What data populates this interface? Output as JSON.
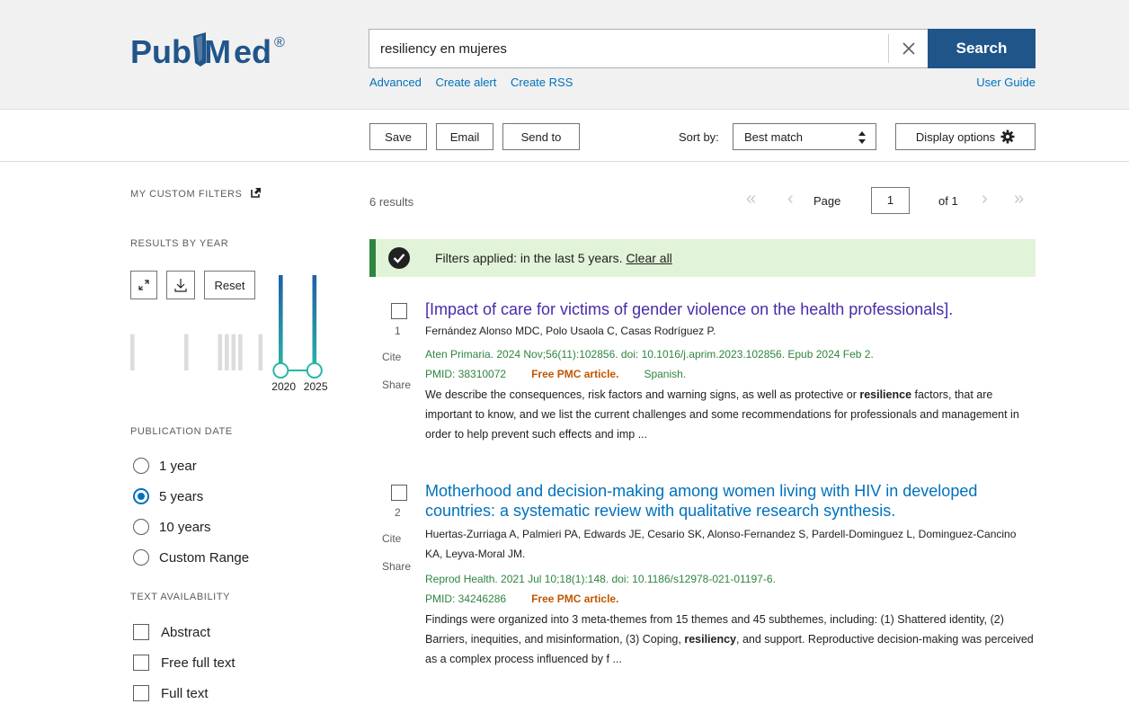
{
  "header": {
    "logo_text_left": "Pub",
    "logo_text_right": "ed",
    "logo_reg": "®",
    "search_value": "resiliency en mujeres",
    "search_button": "Search",
    "links": [
      "Advanced",
      "Create alert",
      "Create RSS"
    ],
    "user_guide": "User Guide"
  },
  "actions": {
    "save": "Save",
    "email": "Email",
    "send_to": "Send to",
    "sort_by_label": "Sort by:",
    "sort_value": "Best match",
    "display_options": "Display options"
  },
  "sidebar": {
    "custom_filters": "MY CUSTOM FILTERS",
    "results_by_year": "RESULTS BY YEAR",
    "reset": "Reset",
    "year_chart": {
      "start_label": "2020",
      "end_label": "2025",
      "selected_range": [
        2020,
        2025
      ],
      "bar_heights": [
        0.38,
        0,
        0,
        0,
        0,
        0,
        0,
        0,
        0.38,
        0,
        0,
        0,
        0,
        0.38,
        0.38,
        0.38,
        0.38,
        0,
        0,
        0.38,
        0,
        0,
        1.0,
        0,
        0,
        0,
        0,
        1.0
      ],
      "highlight_indices": [
        22,
        27
      ],
      "bar_colors": {
        "inactive": "#dcdcdc",
        "top": "#1f5fa8",
        "bottom": "#2ab6a4"
      }
    },
    "publication_date": "PUBLICATION DATE",
    "date_options": [
      {
        "label": "1 year",
        "checked": false
      },
      {
        "label": "5 years",
        "checked": true
      },
      {
        "label": "10 years",
        "checked": false
      },
      {
        "label": "Custom Range",
        "checked": false
      }
    ],
    "text_availability": "TEXT AVAILABILITY",
    "text_options": [
      "Abstract",
      "Free full text",
      "Full text"
    ]
  },
  "main": {
    "results_count": "6 results",
    "pager": {
      "page_label": "Page",
      "page_value": "1",
      "of_label": "of 1"
    },
    "filter_banner": {
      "text": "Filters applied: in the last 5 years.",
      "clear": "Clear all"
    },
    "results": [
      {
        "num": "1",
        "title": "[Impact of care for victims of gender violence on the health professionals].",
        "authors": "Fernández Alonso MDC, Polo Usaola C, Casas Rodríguez P.",
        "journal": "Aten Primaria. 2024 Nov;56(11):102856. doi: 10.1016/j.aprim.2023.102856. Epub 2024 Feb 2.",
        "pmid": "PMID: 38310072",
        "free": "Free PMC article.",
        "lang": "Spanish.",
        "snippet_pre": "We describe the consequences, risk factors and warning signs, as well as protective or ",
        "snippet_bold": "resilience",
        "snippet_post": " factors, that are important to know, and we list the current challenges and some recommendations for professionals and management in order to help prevent such effects and imp ..."
      },
      {
        "num": "2",
        "title": "Motherhood and decision-making among women living with HIV in developed countries: a systematic review with qualitative research synthesis.",
        "authors": "Huertas-Zurriaga A, Palmieri PA, Edwards JE, Cesario SK, Alonso-Fernandez S, Pardell-Dominguez L, Dominguez-Cancino KA, Leyva-Moral JM.",
        "journal": "Reprod Health. 2021 Jul 10;18(1):148. doi: 10.1186/s12978-021-01197-6.",
        "pmid": "PMID: 34246286",
        "free": "Free PMC article.",
        "lang": "",
        "snippet_pre": "Findings were organized into 3 meta-themes from 15 themes and 45 subthemes, including: (1) Shattered identity, (2) Barriers, inequities, and misinformation, (3) Coping, ",
        "snippet_bold": "resiliency",
        "snippet_post": ", and support. Reproductive decision-making was perceived as a complex process influenced by f ..."
      }
    ],
    "cite": "Cite",
    "share": "Share"
  },
  "colors": {
    "primary": "#20558a",
    "link": "#0071bc",
    "visited": "#4b2aa8",
    "green": "#2e8540",
    "free_pmc": "#c05600",
    "banner_bg": "#e1f3d8"
  }
}
